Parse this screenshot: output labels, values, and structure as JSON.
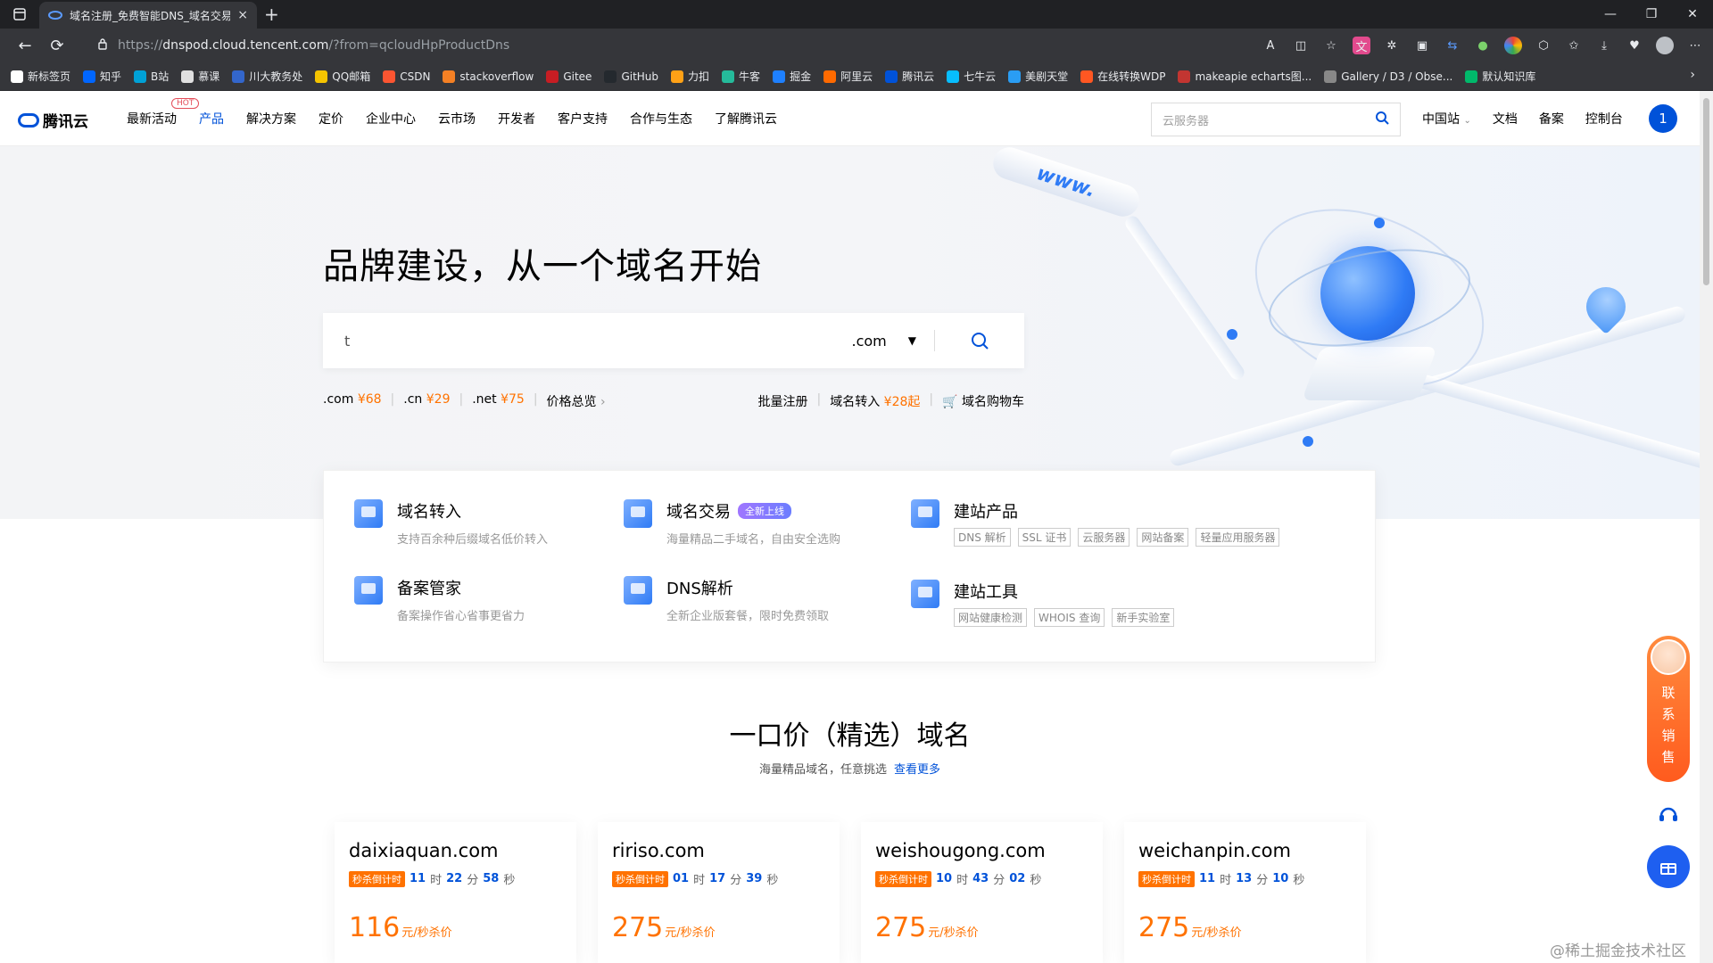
{
  "browser": {
    "tab_title": "域名注册_免费智能DNS_域名交易",
    "tab_close": "×",
    "new_tab": "+",
    "url_protocol": "https://",
    "url_host": "dnspod.cloud.tencent.com",
    "url_path": "/?from=qcloudHpProductDns",
    "bookmarks": [
      {
        "label": "新标签页",
        "color": "#ffffff"
      },
      {
        "label": "知乎",
        "color": "#0066ff"
      },
      {
        "label": "B站",
        "color": "#00a1d6"
      },
      {
        "label": "慕课",
        "color": "#e0e0e0"
      },
      {
        "label": "川大教务处",
        "color": "#3366cc"
      },
      {
        "label": "QQ邮箱",
        "color": "#f5c400"
      },
      {
        "label": "CSDN",
        "color": "#fc5531"
      },
      {
        "label": "stackoverflow",
        "color": "#f48024"
      },
      {
        "label": "Gitee",
        "color": "#c71d23"
      },
      {
        "label": "GitHub",
        "color": "#24292e"
      },
      {
        "label": "力扣",
        "color": "#ffa116"
      },
      {
        "label": "牛客",
        "color": "#25bb9b"
      },
      {
        "label": "掘金",
        "color": "#1e80ff"
      },
      {
        "label": "阿里云",
        "color": "#ff6a00"
      },
      {
        "label": "腾讯云",
        "color": "#0052d9"
      },
      {
        "label": "七牛云",
        "color": "#07beff"
      },
      {
        "label": "美剧天堂",
        "color": "#2a9df4"
      },
      {
        "label": "在线转换WDP",
        "color": "#ff5722"
      },
      {
        "label": "makeapie echarts图...",
        "color": "#c23531"
      },
      {
        "label": "Gallery / D3 / Obse...",
        "color": "#888888"
      },
      {
        "label": "默认知识库",
        "color": "#00b96b"
      }
    ]
  },
  "header": {
    "logo": "腾讯云",
    "hot_badge": "HOT",
    "nav": [
      "最新活动",
      "产品",
      "解决方案",
      "定价",
      "企业中心",
      "云市场",
      "开发者",
      "客户支持",
      "合作与生态",
      "了解腾讯云"
    ],
    "search_placeholder": "云服务器",
    "region": "中国站",
    "links": [
      "文档",
      "备案",
      "控制台"
    ],
    "avatar": "1"
  },
  "hero": {
    "title": "品牌建设，从一个域名开始",
    "input_value": "t",
    "tld": ".com",
    "prices": [
      {
        "tld": ".com",
        "price": "¥68"
      },
      {
        "tld": ".cn",
        "price": "¥29"
      },
      {
        "tld": ".net",
        "price": "¥75"
      }
    ],
    "price_overview": "价格总览",
    "batch_register": "批量注册",
    "transfer_label": "域名转入",
    "transfer_price": "¥28起",
    "cart": "域名购物车",
    "www_text": "www."
  },
  "services": {
    "transfer": {
      "title": "域名转入",
      "desc": "支持百余种后缀域名低价转入"
    },
    "trade": {
      "title": "域名交易",
      "badge": "全新上线",
      "desc": "海量精品二手域名，自由安全选购"
    },
    "site_products": {
      "title": "建站产品",
      "tags": [
        "DNS 解析",
        "SSL 证书",
        "云服务器",
        "网站备案",
        "轻量应用服务器"
      ]
    },
    "icp": {
      "title": "备案管家",
      "desc": "备案操作省心省事更省力"
    },
    "dns": {
      "title": "DNS解析",
      "desc": "全新企业版套餐，限时免费领取"
    },
    "site_tools": {
      "title": "建站工具",
      "tags": [
        "网站健康检测",
        "WHOIS 查询",
        "新手实验室"
      ]
    }
  },
  "featured": {
    "title": "一口价（精选）域名",
    "subtitle": "海量精品域名，任意挑选",
    "more": "查看更多",
    "countdown_label": "秒杀倒计时",
    "unit_h": "时",
    "unit_m": "分",
    "unit_s": "秒",
    "price_unit": "元/秒杀价",
    "items": [
      {
        "domain": "daixiaquan.com",
        "h": "11",
        "m": "22",
        "s": "58",
        "price": "116"
      },
      {
        "domain": "ririso.com",
        "h": "01",
        "m": "17",
        "s": "39",
        "price": "275"
      },
      {
        "domain": "weishougong.com",
        "h": "10",
        "m": "43",
        "s": "02",
        "price": "275"
      },
      {
        "domain": "weichanpin.com",
        "h": "11",
        "m": "13",
        "s": "10",
        "price": "275"
      }
    ]
  },
  "floating": {
    "sales": "联系销售"
  },
  "watermark": "@稀土掘金技术社区",
  "colors": {
    "brand": "#0052d9",
    "price": "#ff7200",
    "hot": "#e34d59"
  }
}
